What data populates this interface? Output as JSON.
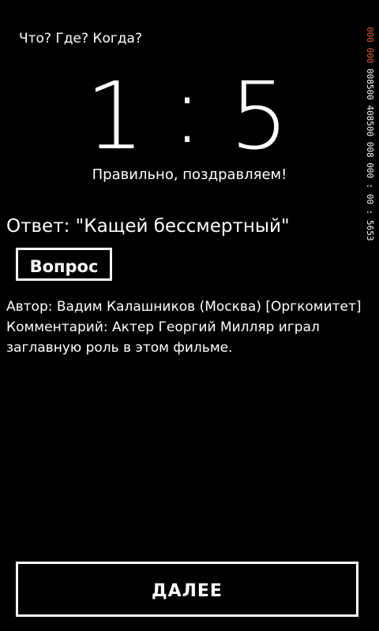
{
  "app": {
    "title": "Что? Где? Когда?"
  },
  "score": {
    "left": "1",
    "separator": ":",
    "right": "5"
  },
  "result_message": "Правильно, поздравляем!",
  "answer": {
    "label": "Ответ: \"Кащей бессмертный\""
  },
  "question_button": {
    "label": "Вопрос"
  },
  "details": {
    "author": "Автор: Вадим Калашников (Москва) [Оргкомитет]",
    "comment": "Комментарий: Актер Георгий Милляр играл заглавную роль в этом фильме."
  },
  "next_button": {
    "label": "ДАЛЕЕ"
  },
  "debug_counter": {
    "accent_text": "000 000",
    "text": " 008500 408500 008 000 : 00 : 5653",
    "accent_color": "#e8643c"
  }
}
